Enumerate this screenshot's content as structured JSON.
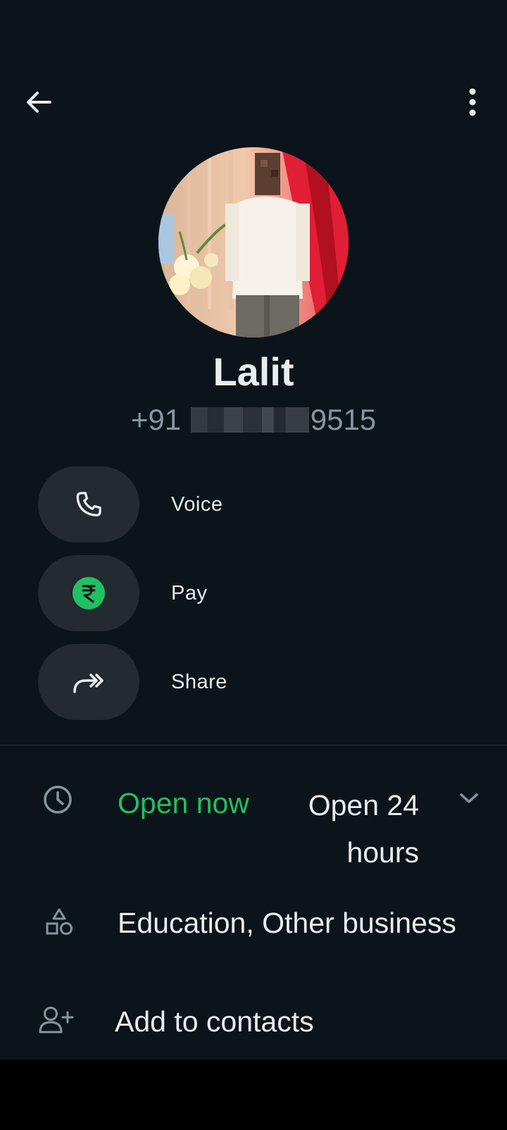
{
  "contact": {
    "name": "Lalit",
    "phone_prefix": "+91",
    "phone_suffix": "9515"
  },
  "actions": [
    {
      "label": "Voice",
      "icon": "phone-icon"
    },
    {
      "label": "Pay",
      "icon": "rupee-icon"
    },
    {
      "label": "Share",
      "icon": "share-forward-icon"
    }
  ],
  "business": {
    "hours_status": "Open now",
    "hours_detail": "Open 24 hours",
    "category": "Education, Other business"
  },
  "add_to_contacts_label": "Add to contacts",
  "colors": {
    "background": "#0b141a",
    "pill": "#232a30",
    "accent_green": "#21c063",
    "text_primary": "#e9edef",
    "text_secondary": "#8696a0"
  }
}
